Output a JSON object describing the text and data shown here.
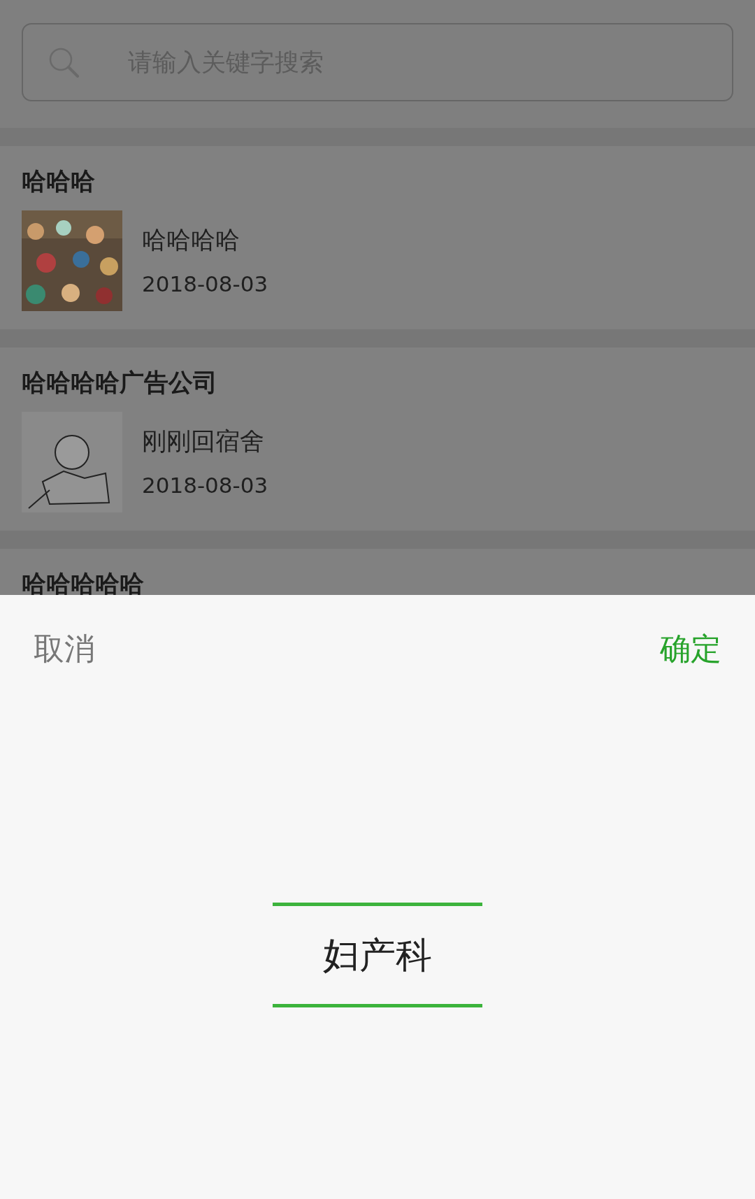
{
  "search": {
    "placeholder": "请输入关键字搜索"
  },
  "posts": [
    {
      "title": "哈哈哈",
      "text": "哈哈哈哈",
      "date": "2018-08-03"
    },
    {
      "title": "哈哈哈哈广告公司",
      "text": "刚刚回宿舍",
      "date": "2018-08-03"
    },
    {
      "title": "哈哈哈哈哈"
    }
  ],
  "picker": {
    "cancel": "取消",
    "confirm": "确定",
    "options": [
      {
        "label": "妇产科",
        "selected": true
      }
    ]
  }
}
